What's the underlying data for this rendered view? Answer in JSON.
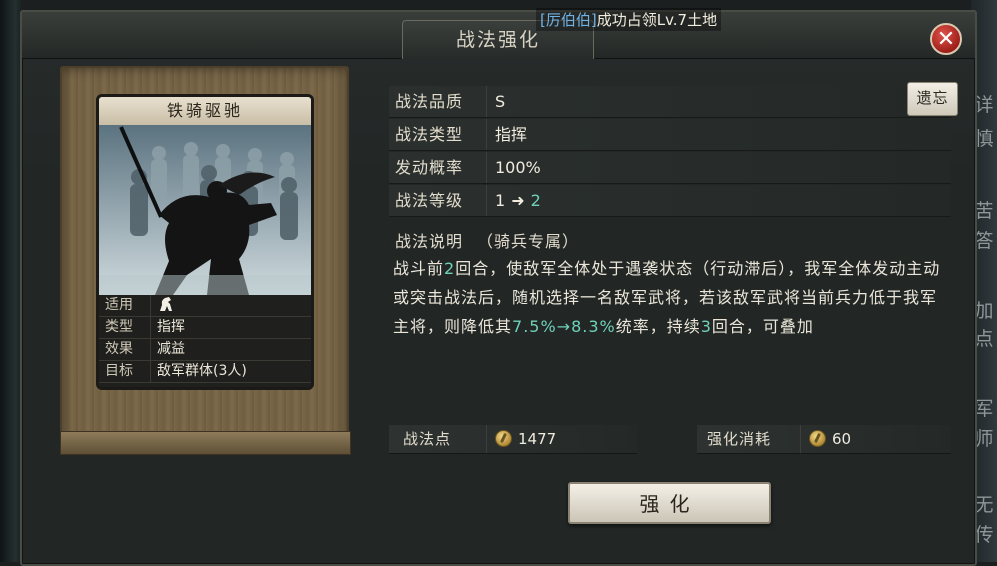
{
  "window": {
    "title": "战法强化",
    "notice_name": "[厉伯伯]",
    "notice_text": "成功占领Lv.7土地"
  },
  "card": {
    "name": "铁骑驱驰",
    "rows": [
      {
        "label": "适用",
        "value": "",
        "icon": "cavalry-horse-icon"
      },
      {
        "label": "类型",
        "value": "指挥"
      },
      {
        "label": "效果",
        "value": "减益"
      },
      {
        "label": "目标",
        "value": "敌军群体(3人)"
      }
    ]
  },
  "attributes": {
    "quality_label": "战法品质",
    "quality_value": "S",
    "type_label": "战法类型",
    "type_value": "指挥",
    "rate_label": "发动概率",
    "rate_value": "100%",
    "level_label": "战法等级",
    "level_from": "1",
    "level_to": "2"
  },
  "remember_button": "遗忘",
  "description": {
    "label": "战法说明",
    "tag": "（骑兵专属）",
    "p1": "战斗前",
    "n1": "2",
    "p2": "回合，使敌军全体处于遇袭状态（行动滞后），我军全体发动主动或突击战法后，随机选择一名敌军武将，若该敌军武将当前兵力低于我军主将，则降低其",
    "n2": "7.5%→8.3%",
    "p3": "统率，持续",
    "n3": "3",
    "p4": "回合，可叠加"
  },
  "points": {
    "label": "战法点",
    "value": "1477",
    "cost_label": "强化消耗",
    "cost_value": "60"
  },
  "enhance_button": "强化",
  "side_text": [
    "详",
    "慎",
    "苦",
    "答",
    "加",
    "点",
    "军",
    "师",
    "无",
    "传"
  ],
  "colors": {
    "highlight": "#6fd1b8",
    "close_red": "#c0352c",
    "scroll_brown": "#7a6748"
  }
}
